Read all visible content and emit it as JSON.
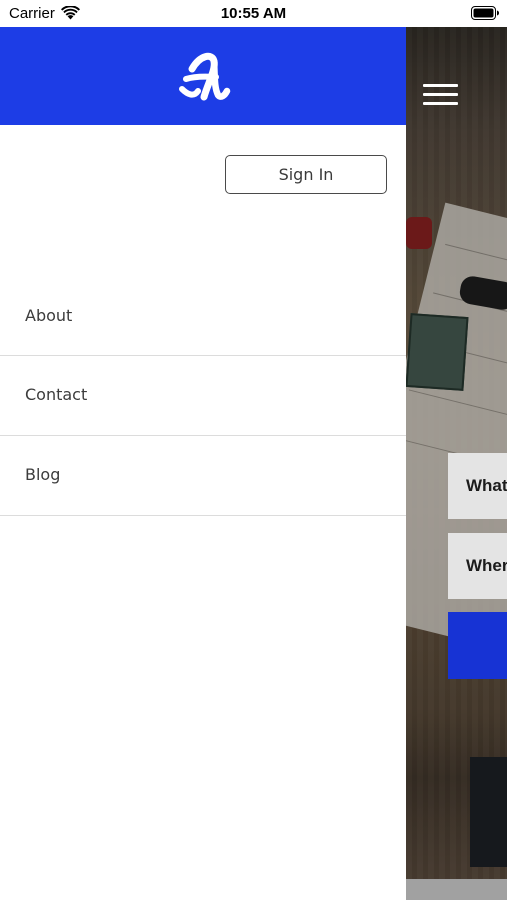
{
  "status_bar": {
    "carrier": "Carrier",
    "time": "10:55 AM"
  },
  "drawer": {
    "sign_in_label": "Sign In",
    "nav_items": [
      {
        "label": "About"
      },
      {
        "label": "Contact"
      },
      {
        "label": "Blog"
      }
    ]
  },
  "background": {
    "question_1": "What",
    "question_2": "Wher"
  },
  "colors": {
    "brand_blue": "#1d3de6",
    "button_blue": "#1733d4"
  },
  "icons": {
    "status": [
      "wifi-icon",
      "battery-icon"
    ],
    "header": "logo-icon",
    "menu": "hamburger-menu-icon"
  }
}
